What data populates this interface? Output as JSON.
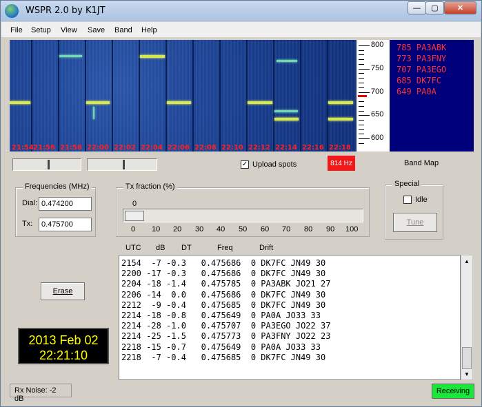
{
  "window": {
    "title": "WSPR 2.0    by K1JT",
    "min_glyph": "—",
    "max_glyph": "▢",
    "close_glyph": "✕"
  },
  "menu": [
    "File",
    "Setup",
    "View",
    "Save",
    "Band",
    "Help"
  ],
  "waterfall": {
    "time_labels": [
      "21:54",
      "21:56",
      "21:58",
      "22:00",
      "22:02",
      "22:04",
      "22:06",
      "22:08",
      "22:10",
      "22:12",
      "22:14",
      "22:16",
      "22:18"
    ],
    "freq_labels": [
      "800",
      "750",
      "700",
      "650",
      "600"
    ]
  },
  "band_map": {
    "entries": [
      "785 PA3ABK",
      "773 PA3FNY",
      "707 PA3EGO",
      "685 DK7FC",
      "649 PA0A"
    ],
    "label": "Band Map"
  },
  "controls": {
    "upload_spots_label": "Upload spots",
    "upload_spots_checked": true,
    "hz_readout": "814 Hz"
  },
  "frequencies": {
    "title": "Frequencies (MHz)",
    "dial_label": "Dial:",
    "dial_value": "0.474200",
    "tx_label": "Tx:",
    "tx_value": "0.475700"
  },
  "tx_fraction": {
    "title": "Tx fraction (%)",
    "value": "0",
    "scale": [
      "0",
      "10",
      "20",
      "30",
      "40",
      "50",
      "60",
      "70",
      "80",
      "90",
      "100"
    ]
  },
  "special": {
    "title": "Special",
    "idle_label": "Idle",
    "idle_checked": false,
    "tune_label": "Tune"
  },
  "log": {
    "headers": [
      "UTC",
      "dB",
      "DT",
      "Freq",
      "Drift"
    ],
    "rows": [
      "2154  -7 -0.3   0.475686  0 DK7FC JN49 30",
      "2200 -17 -0.3   0.475686  0 DK7FC JN49 30",
      "2204 -18 -1.4   0.475785  0 PA3ABK JO21 27",
      "2206 -14  0.0   0.475686  0 DK7FC JN49 30",
      "2212  -9 -0.4   0.475685  0 DK7FC JN49 30",
      "2214 -18 -0.8   0.475649  0 PA0A JO33 33",
      "2214 -28 -1.0   0.475707  0 PA3EGO JO22 37",
      "2214 -25 -1.5   0.475773  0 PA3FNY JO22 23",
      "2218 -15 -0.7   0.475649  0 PA0A JO33 33",
      "2218  -7 -0.4   0.475685  0 DK7FC JN49 30"
    ]
  },
  "erase_label": "Erase",
  "clock": {
    "date": "2013 Feb 02",
    "time": "22:21:10"
  },
  "status": {
    "rx_noise": "Rx Noise: -2 dB",
    "state": "Receiving"
  },
  "colors": {
    "waterfall_bg": "#173b8a",
    "band_map_bg": "#00007a",
    "band_map_text": "#ff3030",
    "receiving": "#18e83a",
    "hz_box": "#f01818",
    "clock_text": "#ffff00"
  }
}
